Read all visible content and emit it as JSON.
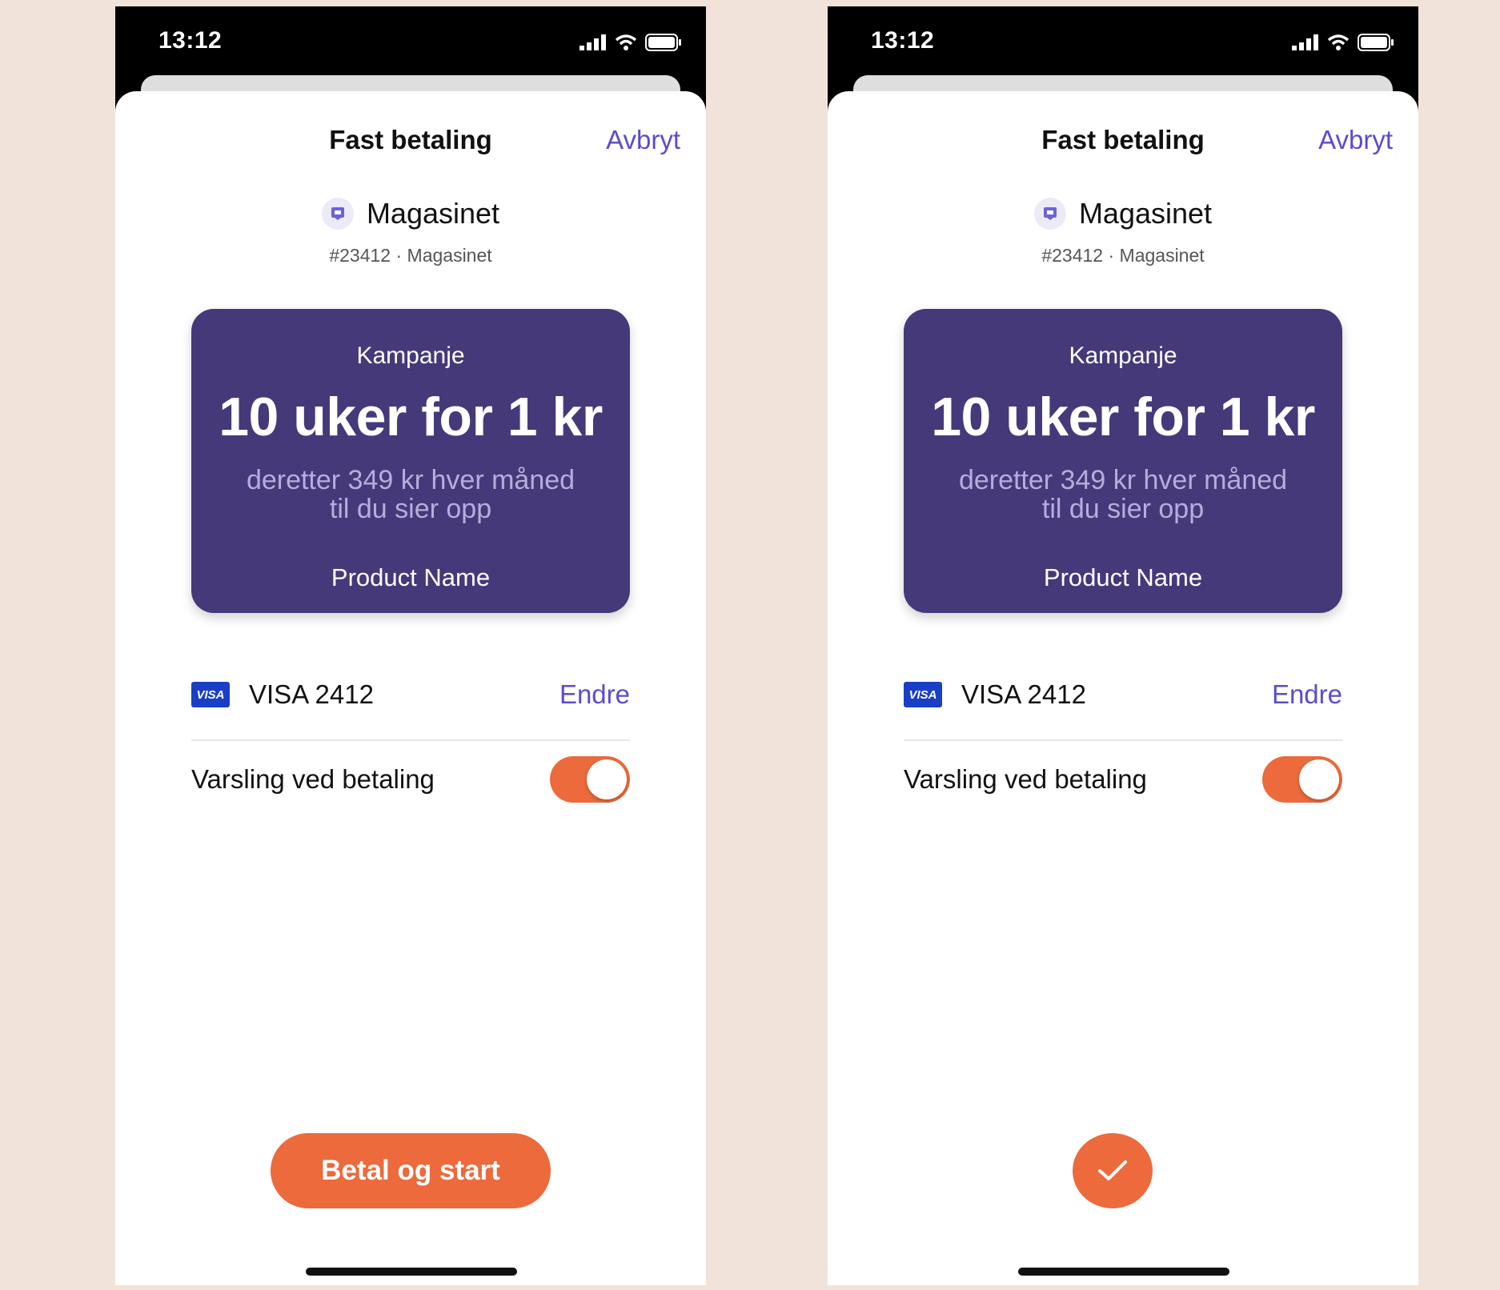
{
  "colors": {
    "background": "#f1e3d9",
    "accent_purple": "#5b4ccf",
    "promo_bg": "#45397a",
    "orange": "#ec6a3c",
    "visa_blue": "#1a3ec4"
  },
  "icons": [
    "signal-icon",
    "wifi-icon",
    "battery-icon",
    "merchant-icon",
    "visa-icon",
    "checkmark-icon"
  ],
  "screens": [
    {
      "status_time": "13:12",
      "title": "Fast betaling",
      "cancel_label": "Avbryt",
      "merchant_name": "Magasinet",
      "merchant_sub": "#23412 · Magasinet",
      "promo": {
        "label": "Kampanje",
        "headline": "10 uker for 1 kr",
        "sub_line1": "deretter 349 kr hver måned",
        "sub_line2": "til du sier opp",
        "product": "Product Name"
      },
      "card_brand": "VISA",
      "card_label": "VISA 2412",
      "change_label": "Endre",
      "notify_label": "Varsling ved betaling",
      "notify_on": true,
      "pay_label": "Betal og start"
    },
    {
      "status_time": "13:12",
      "title": "Fast betaling",
      "cancel_label": "Avbryt",
      "merchant_name": "Magasinet",
      "merchant_sub": "#23412 · Magasinet",
      "promo": {
        "label": "Kampanje",
        "headline": "10 uker for 1 kr",
        "sub_line1": "deretter 349 kr hver måned",
        "sub_line2": "til du sier opp",
        "product": "Product Name"
      },
      "card_brand": "VISA",
      "card_label": "VISA 2412",
      "change_label": "Endre",
      "notify_label": "Varsling ved betaling",
      "notify_on": true,
      "state": "confirmed"
    }
  ]
}
